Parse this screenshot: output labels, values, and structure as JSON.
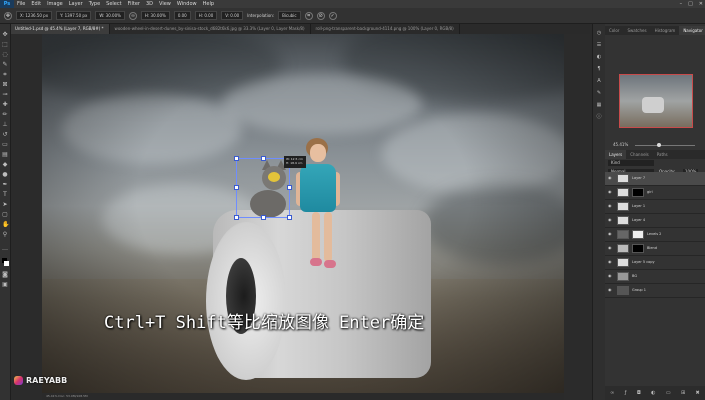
{
  "app": {
    "logo": "Ps"
  },
  "menu": {
    "items": [
      "File",
      "Edit",
      "Image",
      "Layer",
      "Type",
      "Select",
      "Filter",
      "3D",
      "View",
      "Window",
      "Help"
    ]
  },
  "window_controls": [
    "–",
    "□",
    "✕"
  ],
  "options_bar": {
    "x": "X: 1236.50 px",
    "y": "Y: 1397.50 px",
    "w": "W: 30.00%",
    "h": "H: 30.00%",
    "angle": "0.00",
    "h_skew": "H: 0.00",
    "v_skew": "V: 0.00",
    "interpolation_label": "Interpolation:",
    "interpolation_value": "Bicubic",
    "cancel_icon": "cancel-icon",
    "commit_icon": "commit-icon"
  },
  "tabs": [
    {
      "label": "Untitled-1.psd @ 45.4% (Layer 7, RGB/8#) *",
      "active": true
    },
    {
      "label": "wooden-wheel-in-desert-dunes_by-sinisa-stock_d682t6k6.jpg @ 33.3% (Layer 0, Layer Mask/8)",
      "active": false
    },
    {
      "label": "roll-png-transparent-background-4114.png @ 100% (Layer 0, RGB/8)",
      "active": false
    }
  ],
  "canvas": {
    "transform_info": [
      "W: 12.5 cm",
      "H: 18.9 cm"
    ],
    "subtitle": "Ctrl+T Shift等比缩放图像 Enter确定",
    "watermark": "RAEYABB"
  },
  "status_bar": "45.41%    Doc: 53.0M/108.5M",
  "navigator": {
    "tabs": [
      {
        "label": "Color",
        "active": false
      },
      {
        "label": "Swatches",
        "active": false
      },
      {
        "label": "Histogram",
        "active": false
      },
      {
        "label": "Navigator",
        "active": true
      }
    ],
    "zoom": "45.41%"
  },
  "layers_panel": {
    "tabs": [
      {
        "label": "Layers",
        "active": true
      },
      {
        "label": "Channels",
        "active": false
      },
      {
        "label": "Paths",
        "active": false
      }
    ],
    "kind_label": "Kind",
    "blend_mode": "Normal",
    "opacity_label": "Opacity:",
    "opacity_value": "100%",
    "lock_label": "Lock:",
    "fill_label": "Fill:",
    "fill_value": "100%",
    "layers": [
      {
        "name": "Layer 7",
        "selected": true,
        "mask": false
      },
      {
        "name": "girl",
        "selected": false,
        "mask": true
      },
      {
        "name": "Layer 1",
        "selected": false,
        "mask": false
      },
      {
        "name": "Layer 4",
        "selected": false,
        "mask": false
      },
      {
        "name": "Levels 2",
        "selected": false,
        "mask": true
      },
      {
        "name": "Blend",
        "selected": false,
        "mask": true
      },
      {
        "name": "Layer 5 copy",
        "selected": false,
        "mask": false
      },
      {
        "name": "BG",
        "selected": false,
        "mask": false
      },
      {
        "name": "Group 1",
        "selected": false,
        "mask": false
      }
    ],
    "bottom_icons": [
      "link-icon",
      "fx-icon",
      "mask-icon",
      "adjustment-icon",
      "folder-icon",
      "new-layer-icon",
      "trash-icon"
    ]
  }
}
